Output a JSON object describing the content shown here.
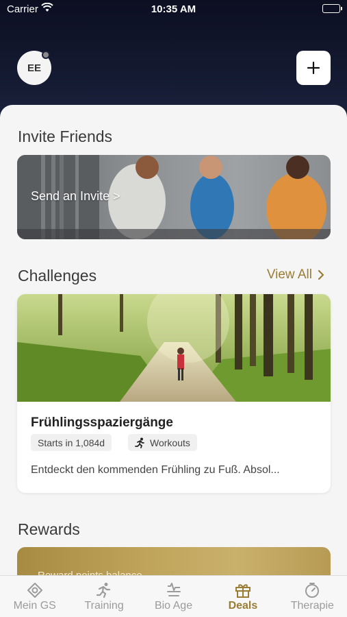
{
  "status_bar": {
    "carrier": "Carrier",
    "time": "10:35 AM"
  },
  "header": {
    "avatar_initials": "EE"
  },
  "invite": {
    "title": "Invite Friends",
    "cta": "Send an Invite >"
  },
  "challenges": {
    "title": "Challenges",
    "view_all": "View All",
    "card": {
      "title": "Frühlingsspaziergänge",
      "starts": "Starts in 1,084d",
      "category": "Workouts",
      "description": "Entdeckt den kommenden Frühling zu Fuß. Absol..."
    }
  },
  "rewards": {
    "title": "Rewards",
    "balance_label": "Reward points balance"
  },
  "tabs": [
    {
      "label": "Mein GS",
      "icon": "eye-diamond-icon"
    },
    {
      "label": "Training",
      "icon": "running-person-icon"
    },
    {
      "label": "Bio Age",
      "icon": "heartbeat-icon"
    },
    {
      "label": "Deals",
      "icon": "gift-icon"
    },
    {
      "label": "Therapie",
      "icon": "stopwatch-icon"
    }
  ],
  "colors": {
    "accent": "#9a7d34",
    "header": "#151b33",
    "inactive": "#9b9b9b"
  }
}
